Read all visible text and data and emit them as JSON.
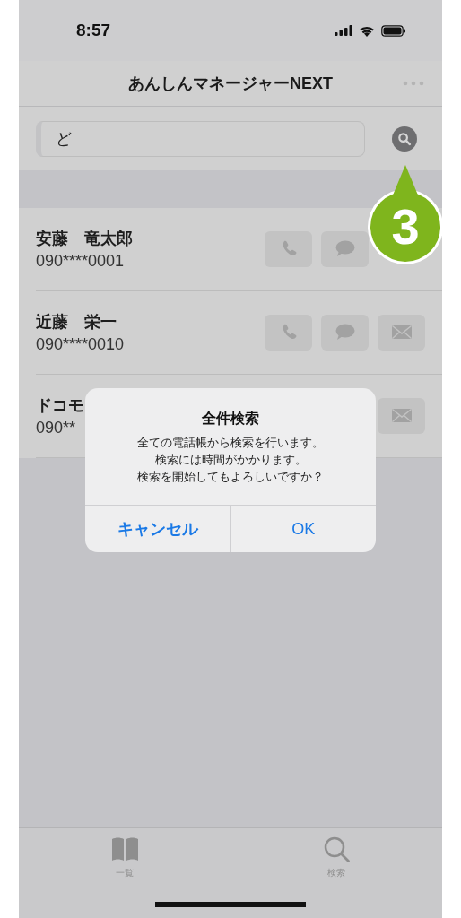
{
  "status_bar": {
    "time": "8:57"
  },
  "nav_bar": {
    "title": "あんしんマネージャーNEXT"
  },
  "search": {
    "value": "ど"
  },
  "contacts": [
    {
      "name": "安藤　竜太郎",
      "phone": "090****0001",
      "actions": [
        {
          "kind": "call"
        },
        {
          "kind": "message"
        }
      ]
    },
    {
      "name": "近藤　栄一",
      "phone": "090****0010",
      "actions": [
        {
          "kind": "call"
        },
        {
          "kind": "message"
        },
        {
          "kind": "mail"
        }
      ]
    },
    {
      "name": "ドコモ",
      "phone": "090**",
      "actions": [
        {
          "kind": "mail"
        }
      ]
    }
  ],
  "dialog": {
    "title": "全件検索",
    "message": [
      "全ての電話帳から検索を行います。",
      "検索には時間がかかります。",
      "検索を開始してもよろしいですか？"
    ],
    "buttons": [
      {
        "label": "キャンセル",
        "kind": "cancel"
      },
      {
        "label": "OK",
        "kind": "default"
      }
    ]
  },
  "callout": {
    "number": "3"
  },
  "tab_bar": [
    {
      "label": "一覧",
      "kind": "list"
    },
    {
      "label": "検索",
      "kind": "search"
    }
  ]
}
